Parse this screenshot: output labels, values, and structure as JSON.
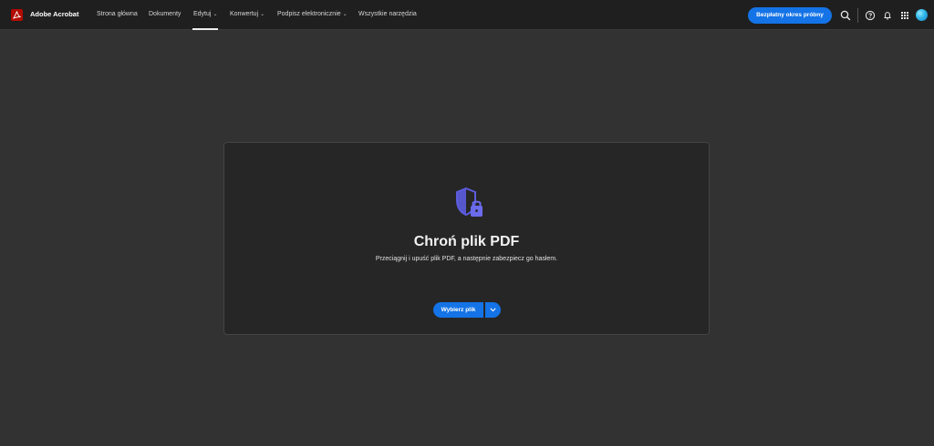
{
  "header": {
    "brand": "Adobe Acrobat",
    "logo_icon": "acrobat-logo-icon",
    "nav": [
      {
        "label": "Strona główna",
        "dropdown": false
      },
      {
        "label": "Dokumenty",
        "dropdown": false
      },
      {
        "label": "Edytuj",
        "dropdown": true,
        "active": true
      },
      {
        "label": "Konwertuj",
        "dropdown": true
      },
      {
        "label": "Podpisz elektronicznie",
        "dropdown": true
      },
      {
        "label": "Wszystkie narzędzia",
        "dropdown": false
      }
    ],
    "trial_button": "Bezpłatny okres próbny",
    "icons": [
      "search-icon",
      "help-icon",
      "bell-icon",
      "apps-grid-icon",
      "avatar"
    ]
  },
  "card": {
    "icon": "shield-lock-icon",
    "title": "Chroń plik PDF",
    "subtitle": "Przeciągnij i upuść plik PDF, a następnie zabezpiecz go hasłem.",
    "choose_button": "Wybierz plik",
    "dropdown_icon": "chevron-down-icon"
  },
  "colors": {
    "page_bg": "#323232",
    "header_bg": "#1f1f1f",
    "card_bg": "#262626",
    "accent_blue": "#1473e6",
    "acrobat_red": "#b30b00",
    "icon_purple": "#5c5ce0"
  }
}
